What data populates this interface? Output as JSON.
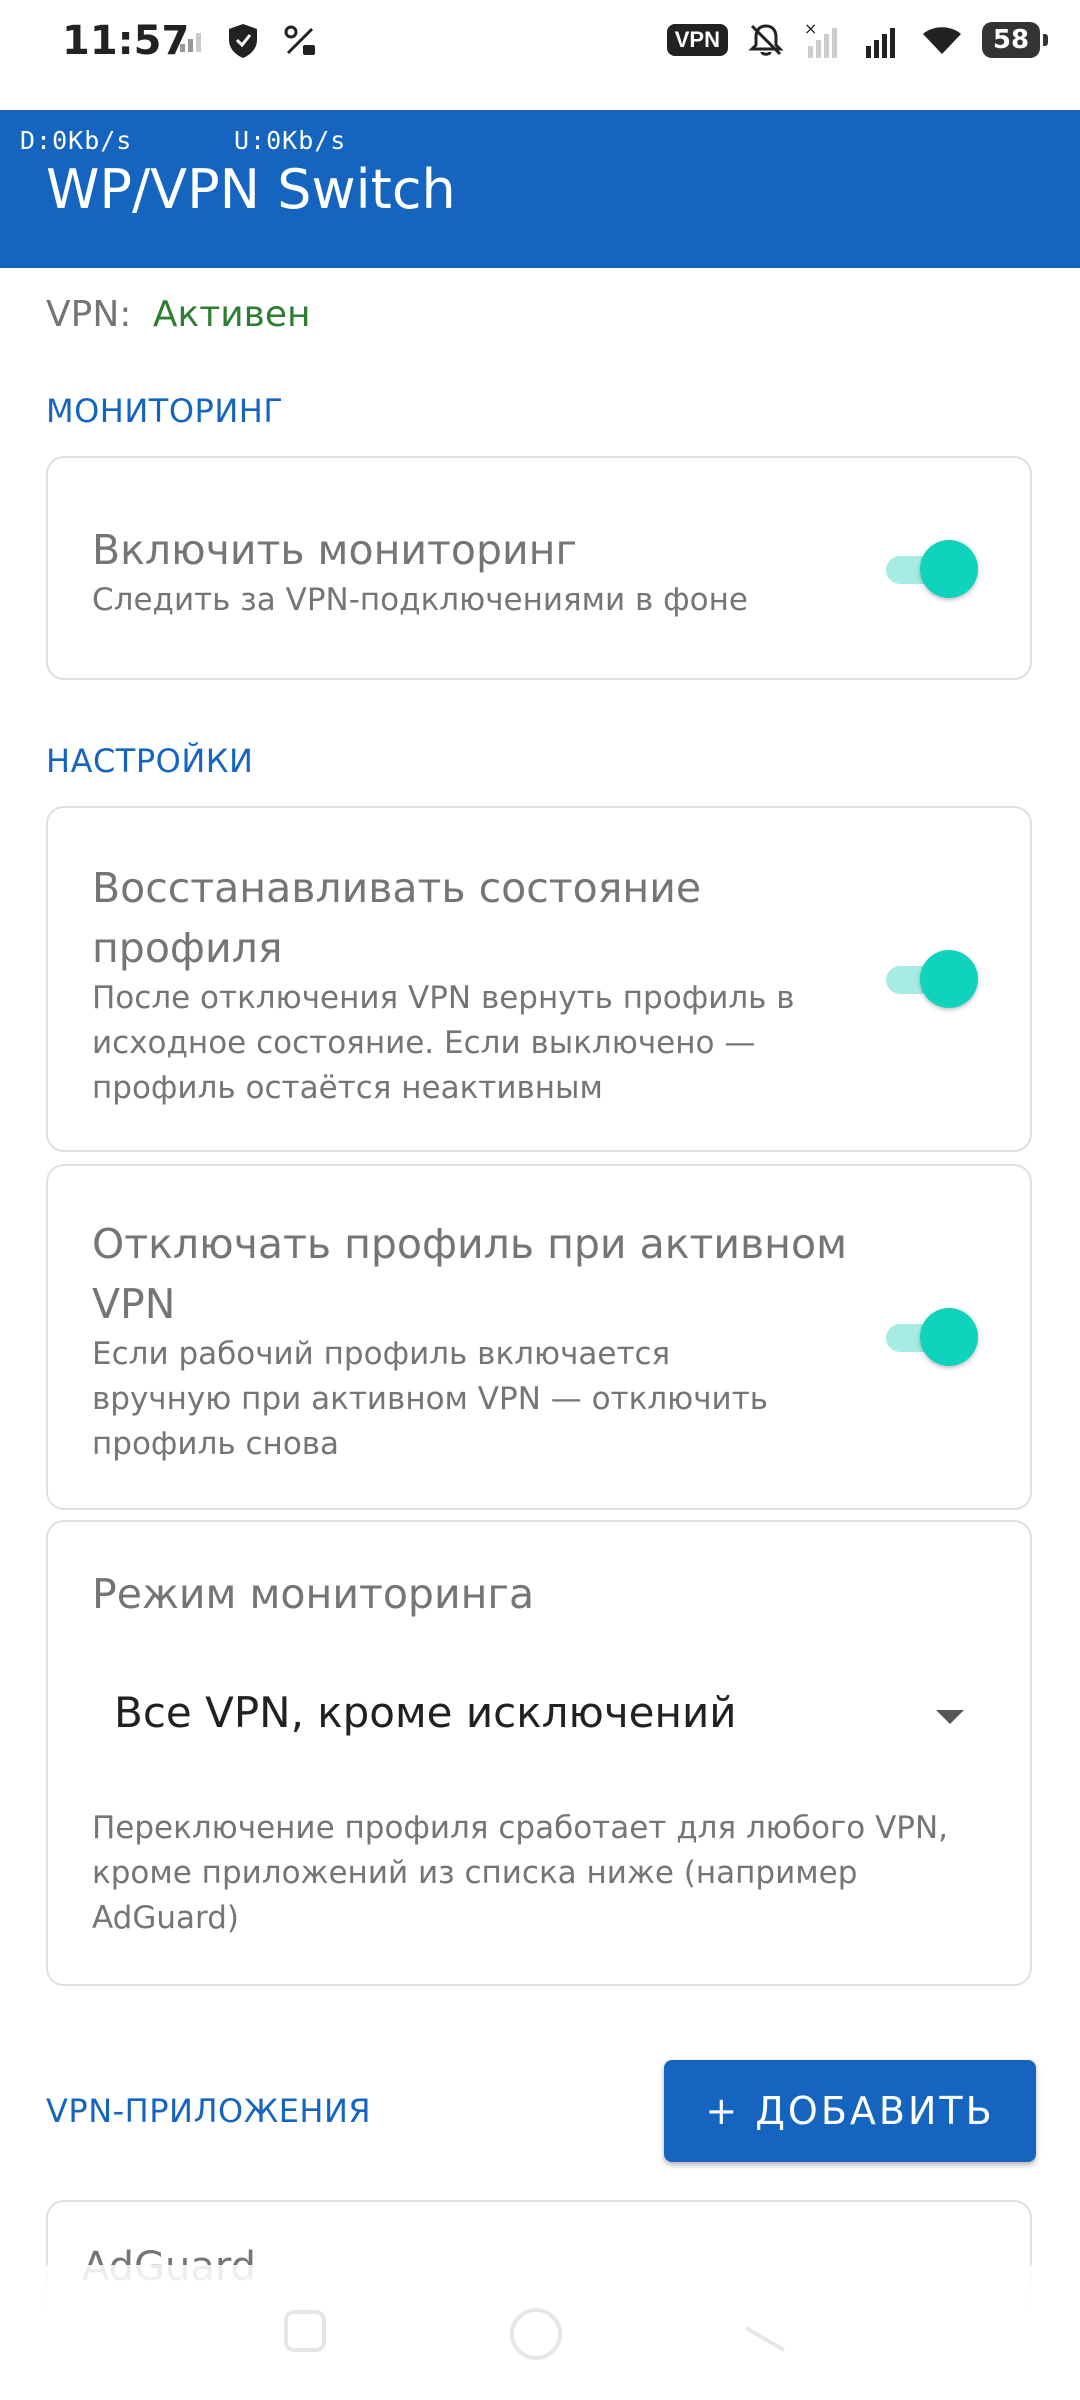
{
  "status_bar": {
    "time": "11:57",
    "vpn_chip": "VPN",
    "battery": "58"
  },
  "app_bar": {
    "download_speed": "D:0Kb/s",
    "upload_speed": "U:0Kb/s",
    "title": "WP/VPN Switch"
  },
  "vpn_status": {
    "label": "VPN:",
    "value": "Активен"
  },
  "monitoring_section": {
    "header": "МОНИТОРИНГ",
    "enable": {
      "title": "Включить мониторинг",
      "subtitle": "Следить за VPN-подключениями в фоне",
      "on": true
    }
  },
  "settings_section": {
    "header": "НАСТРОЙКИ",
    "restore_profile": {
      "title": "Восстанавливать состояние профиля",
      "subtitle": "После отключения VPN вернуть профиль в исходное состояние. Если выключено — профиль остаётся неактивным",
      "on": true
    },
    "disable_profile": {
      "title": "Отключать профиль при активном VPN",
      "subtitle": "Если рабочий профиль включается вручную при активном VPN — отключить профиль снова",
      "on": true
    },
    "monitoring_mode": {
      "title": "Режим мониторинга",
      "selected": "Все VPN, кроме исключений",
      "description": "Переключение профиля сработает для любого VPN, кроме приложений из списка ниже (например AdGuard)"
    }
  },
  "vpn_apps_section": {
    "header": "VPN-ПРИЛОЖЕНИЯ",
    "add_button": "+ ДОБАВИТЬ",
    "items": [
      {
        "label": "AdGuard"
      }
    ]
  },
  "colors": {
    "primary": "#1565c0",
    "active_green": "#2e7d32",
    "switch_thumb": "#0fd3bd",
    "switch_track": "#a6ece2"
  }
}
